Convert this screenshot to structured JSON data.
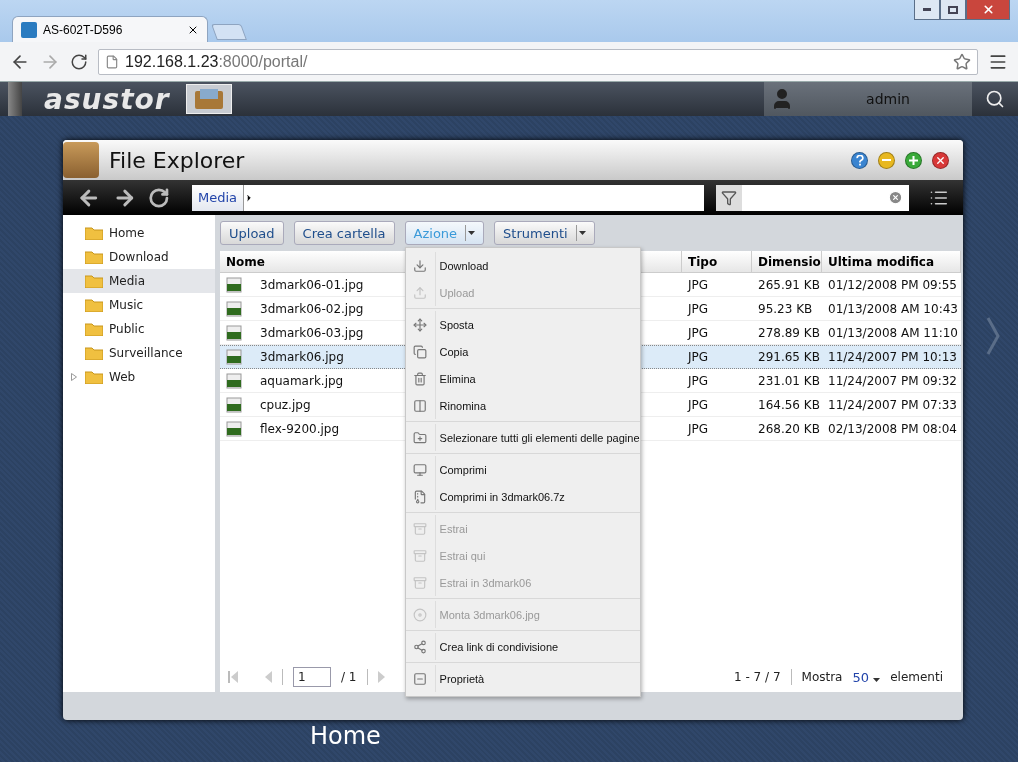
{
  "browser": {
    "tab_title": "AS-602T-D596",
    "url_host": "192.168.1.23",
    "url_rest": ":8000/portal/"
  },
  "portal": {
    "logo": "asustor",
    "user": "admin"
  },
  "desktop": {
    "label": "Home"
  },
  "window": {
    "title": "File Explorer"
  },
  "breadcrumb": [
    "Media"
  ],
  "sidebar": {
    "items": [
      {
        "label": "Home",
        "selected": false,
        "expandable": false
      },
      {
        "label": "Download",
        "selected": false,
        "expandable": false
      },
      {
        "label": "Media",
        "selected": true,
        "expandable": false
      },
      {
        "label": "Music",
        "selected": false,
        "expandable": false
      },
      {
        "label": "Public",
        "selected": false,
        "expandable": false
      },
      {
        "label": "Surveillance",
        "selected": false,
        "expandable": false
      },
      {
        "label": "Web",
        "selected": false,
        "expandable": true
      }
    ]
  },
  "toolbar": [
    {
      "label": "Upload",
      "dropdown": false,
      "open": false
    },
    {
      "label": "Crea cartella",
      "dropdown": false,
      "open": false
    },
    {
      "label": "Azione",
      "dropdown": true,
      "open": true
    },
    {
      "label": "Strumenti",
      "dropdown": true,
      "open": false
    }
  ],
  "menu": [
    [
      {
        "label": "Download",
        "disabled": false
      },
      {
        "label": "Upload",
        "disabled": true
      }
    ],
    [
      {
        "label": "Sposta",
        "disabled": false
      },
      {
        "label": "Copia",
        "disabled": false
      },
      {
        "label": "Elimina",
        "disabled": false
      },
      {
        "label": "Rinomina",
        "disabled": false
      }
    ],
    [
      {
        "label": "Selezionare tutti gli elementi delle pagine",
        "disabled": false
      }
    ],
    [
      {
        "label": "Comprimi",
        "disabled": false
      },
      {
        "label": "Comprimi in 3dmark06.7z",
        "disabled": false
      }
    ],
    [
      {
        "label": "Estrai",
        "disabled": true
      },
      {
        "label": "Estrai qui",
        "disabled": true
      },
      {
        "label": "Estrai in 3dmark06",
        "disabled": true
      }
    ],
    [
      {
        "label": "Monta 3dmark06.jpg",
        "disabled": true
      }
    ],
    [
      {
        "label": "Crea link di condivisione",
        "disabled": false
      }
    ],
    [
      {
        "label": "Proprietà",
        "disabled": false
      }
    ]
  ],
  "table": {
    "columns": [
      "Nome",
      "Tipo",
      "Dimensio",
      "Ultima modifica"
    ],
    "rows": [
      {
        "name": "3dmark06-01.jpg",
        "type": "JPG",
        "size": "265.91 KB",
        "modified": "01/12/2008 PM 09:55",
        "selected": false
      },
      {
        "name": "3dmark06-02.jpg",
        "type": "JPG",
        "size": "95.23 KB",
        "modified": "01/13/2008 AM 10:43",
        "selected": false
      },
      {
        "name": "3dmark06-03.jpg",
        "type": "JPG",
        "size": "278.89 KB",
        "modified": "01/13/2008 AM 11:10",
        "selected": false
      },
      {
        "name": "3dmark06.jpg",
        "type": "JPG",
        "size": "291.65 KB",
        "modified": "11/24/2007 PM 10:13",
        "selected": true
      },
      {
        "name": "aquamark.jpg",
        "type": "JPG",
        "size": "231.01 KB",
        "modified": "11/24/2007 PM 09:32",
        "selected": false
      },
      {
        "name": "cpuz.jpg",
        "type": "JPG",
        "size": "164.56 KB",
        "modified": "11/24/2007 PM 07:33",
        "selected": false
      },
      {
        "name": "flex-9200.jpg",
        "type": "JPG",
        "size": "268.20 KB",
        "modified": "02/13/2008 PM 08:04",
        "selected": false
      }
    ]
  },
  "pager": {
    "page": "1",
    "total": "/ 1",
    "range": "1 - 7 / 7",
    "show_label": "Mostra",
    "per_page": "50",
    "items_label": "elementi"
  }
}
